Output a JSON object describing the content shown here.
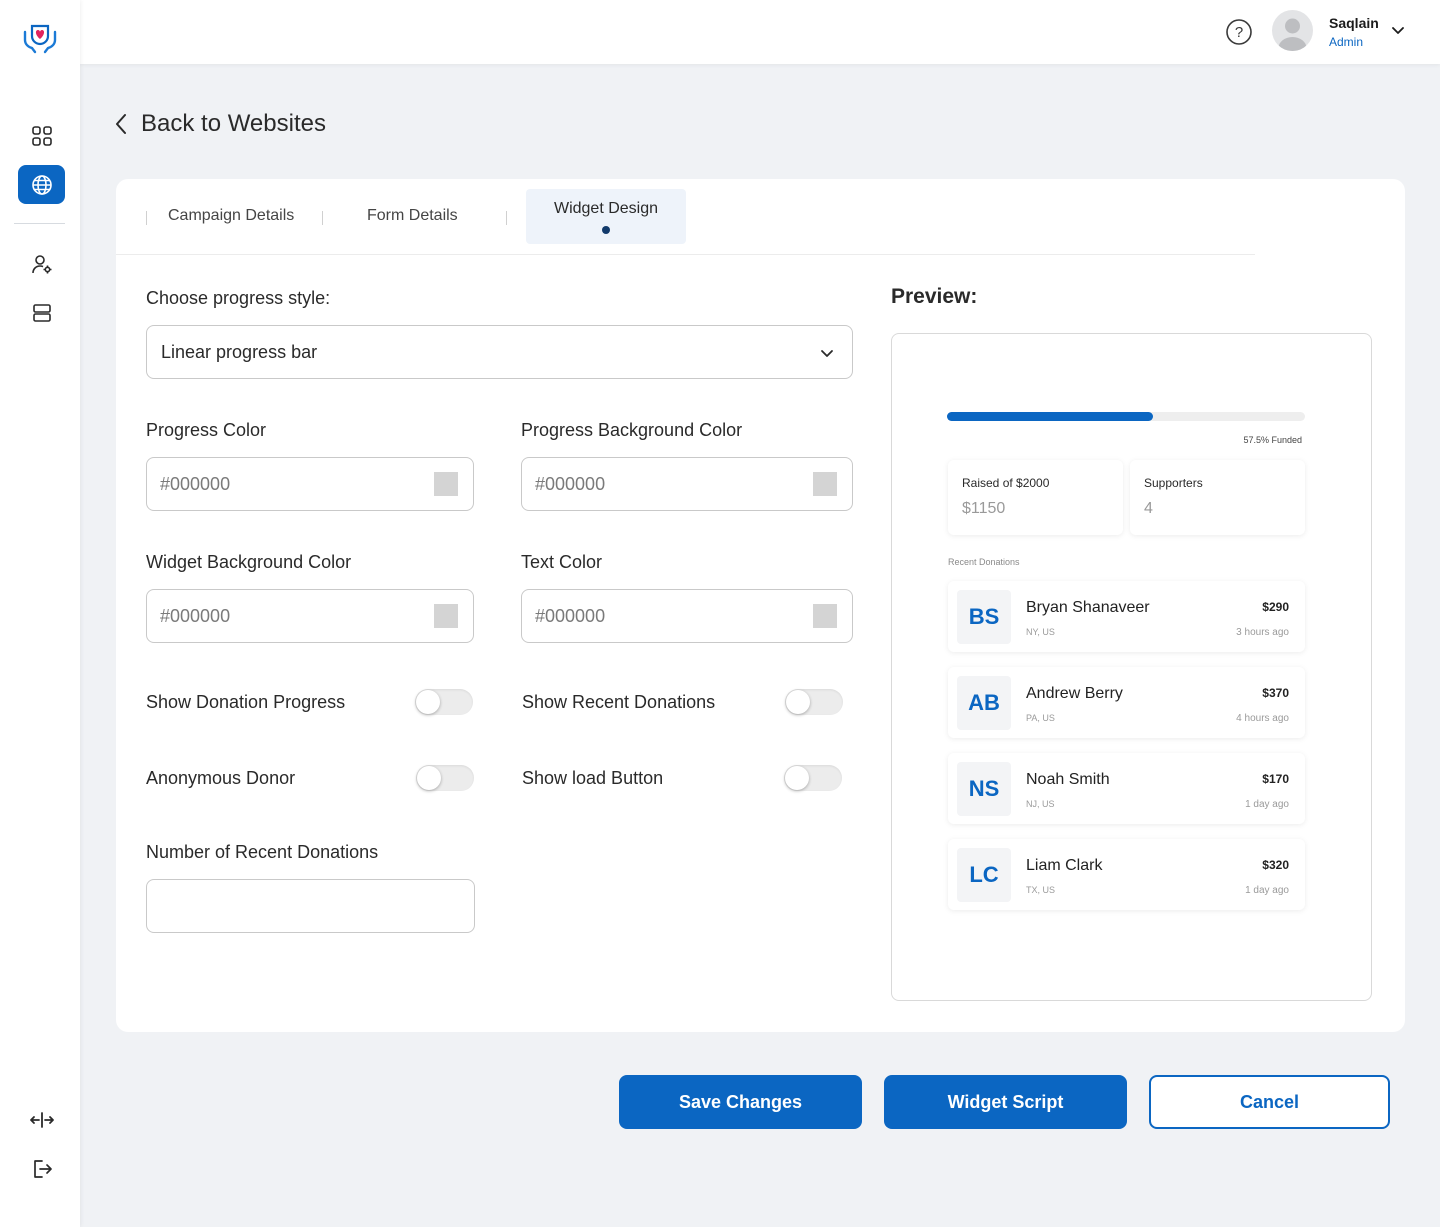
{
  "header": {
    "user_name": "Saqlain",
    "user_role": "Admin"
  },
  "page": {
    "back_label": "Back to Websites"
  },
  "tabs": [
    {
      "label": "Campaign Details",
      "active": false
    },
    {
      "label": "Form Details",
      "active": false
    },
    {
      "label": "Widget Design",
      "active": true
    }
  ],
  "form": {
    "progress_style_label": "Choose progress style:",
    "progress_style_value": "Linear progress bar",
    "progress_color_label": "Progress Color",
    "progress_color_value": "#000000",
    "progress_bg_color_label": "Progress Background Color",
    "progress_bg_color_value": "#000000",
    "widget_bg_color_label": "Widget Background Color",
    "widget_bg_color_value": "#000000",
    "text_color_label": "Text Color",
    "text_color_value": "#000000",
    "show_donation_progress_label": "Show Donation Progress",
    "show_donation_progress": false,
    "show_recent_donations_label": "Show Recent Donations",
    "show_recent_donations": false,
    "anonymous_donor_label": "Anonymous Donor",
    "anonymous_donor": false,
    "show_load_button_label": "Show load Button",
    "show_load_button": false,
    "num_recent_donations_label": "Number of Recent Donations",
    "num_recent_donations_value": ""
  },
  "preview": {
    "title": "Preview:",
    "progress_fraction": 0.575,
    "funded_text": "57.5% Funded",
    "raised_label": "Raised of $2000",
    "raised_value": "$1150",
    "supporters_label": "Supporters",
    "supporters_value": "4",
    "recent_label": "Recent Donations",
    "donations": [
      {
        "initials": "BS",
        "name": "Bryan Shanaveer",
        "location": "NY, US",
        "amount": "$290",
        "time": "3 hours ago"
      },
      {
        "initials": "AB",
        "name": "Andrew Berry",
        "location": "PA, US",
        "amount": "$370",
        "time": "4 hours ago"
      },
      {
        "initials": "NS",
        "name": "Noah Smith",
        "location": "NJ, US",
        "amount": "$170",
        "time": "1 day ago"
      },
      {
        "initials": "LC",
        "name": "Liam Clark",
        "location": "TX, US",
        "amount": "$320",
        "time": "1 day ago"
      }
    ]
  },
  "actions": {
    "save_label": "Save Changes",
    "script_label": "Widget Script",
    "cancel_label": "Cancel"
  },
  "colors": {
    "accent": "#0b66c2",
    "swatch": "#d4d4d4"
  },
  "icons": {
    "logo": "heart-hands-logo",
    "dashboard": "grid-icon",
    "websites": "globe-icon",
    "users": "user-gear-icon",
    "storage": "server-icon",
    "collapse": "arrows-horizontal-icon",
    "logout": "logout-icon",
    "help": "question-icon"
  }
}
